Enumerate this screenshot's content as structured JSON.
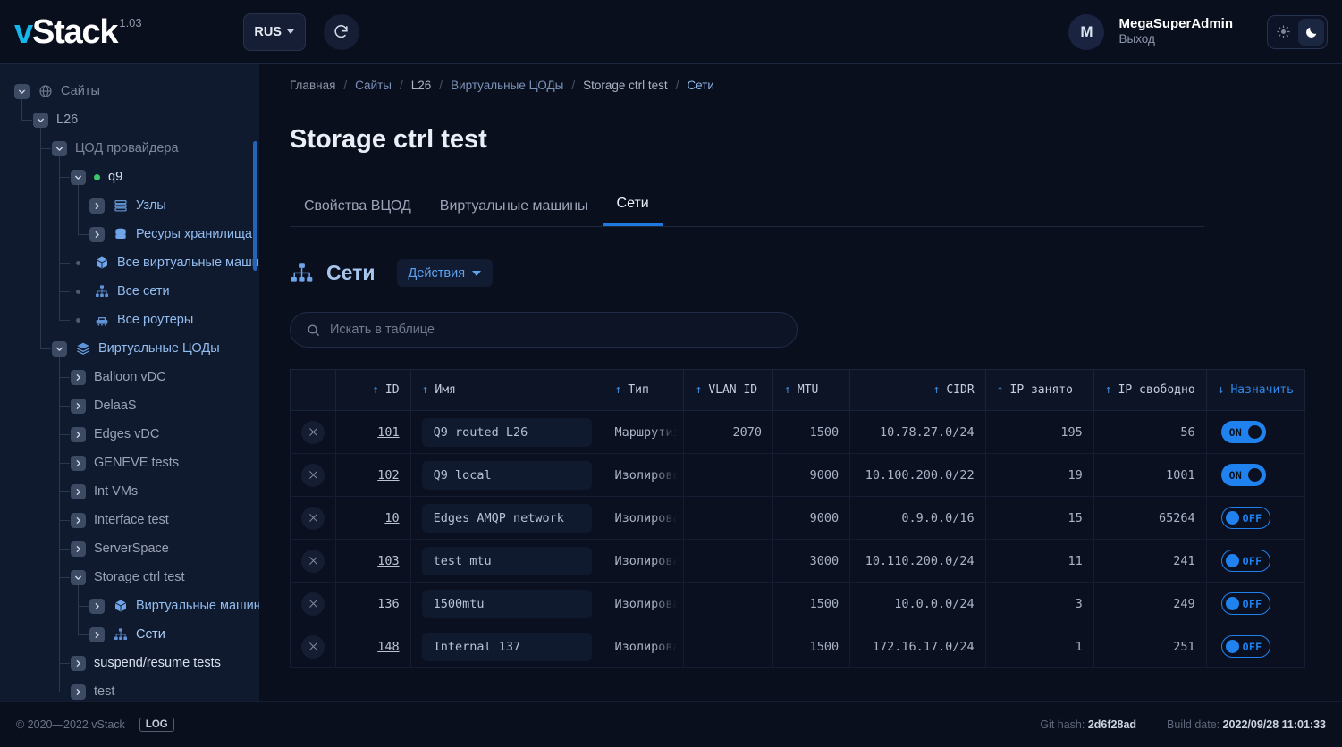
{
  "header": {
    "logo_v": "v",
    "logo_rest": "Stack",
    "version": "1.03",
    "language": "RUS",
    "refresh_icon": "refresh-icon",
    "user_initial": "M",
    "user_name": "MegaSuperAdmin",
    "logout_label": "Выход",
    "theme_light_icon": "sun-icon",
    "theme_dark_icon": "moon-icon",
    "active_theme": "dark"
  },
  "sidebar": {
    "items": [
      {
        "label": "Сайты",
        "indent": 0,
        "state": "expanded",
        "icon": "globe-icon",
        "color": "c-muted"
      },
      {
        "label": "L26",
        "indent": 1,
        "state": "expanded",
        "icon": "",
        "color": "c-dim"
      },
      {
        "label": "ЦОД провайдера",
        "indent": 2,
        "state": "expanded",
        "icon": "",
        "color": "c-muted"
      },
      {
        "label": "q9",
        "indent": 3,
        "state": "expanded",
        "icon": "status-dot",
        "color": "c-white"
      },
      {
        "label": "Узлы",
        "indent": 4,
        "state": "collapsed",
        "icon": "nodes-icon",
        "color": "c-link"
      },
      {
        "label": "Ресуры хранилища",
        "indent": 4,
        "state": "collapsed",
        "icon": "storage-icon",
        "color": "c-link"
      },
      {
        "label": "Все виртуальные машины",
        "indent": 3,
        "state": "leaf",
        "icon": "cube-icon",
        "color": "c-link"
      },
      {
        "label": "Все сети",
        "indent": 3,
        "state": "leaf",
        "icon": "network-icon",
        "color": "c-link"
      },
      {
        "label": "Все роутеры",
        "indent": 3,
        "state": "leaf",
        "icon": "router-icon",
        "color": "c-link"
      },
      {
        "label": "Виртуальные ЦОДы",
        "indent": 2,
        "state": "expanded",
        "icon": "layers-icon",
        "color": "c-link"
      },
      {
        "label": "Balloon vDC",
        "indent": 3,
        "state": "collapsed",
        "icon": "",
        "color": "c-dim"
      },
      {
        "label": "DelaaS",
        "indent": 3,
        "state": "collapsed",
        "icon": "",
        "color": "c-dim"
      },
      {
        "label": "Edges vDC",
        "indent": 3,
        "state": "collapsed",
        "icon": "",
        "color": "c-dim"
      },
      {
        "label": "GENEVE tests",
        "indent": 3,
        "state": "collapsed",
        "icon": "",
        "color": "c-dim"
      },
      {
        "label": "Int VMs",
        "indent": 3,
        "state": "collapsed",
        "icon": "",
        "color": "c-dim"
      },
      {
        "label": "Interface test",
        "indent": 3,
        "state": "collapsed",
        "icon": "",
        "color": "c-dim"
      },
      {
        "label": "ServerSpace",
        "indent": 3,
        "state": "collapsed",
        "icon": "",
        "color": "c-dim"
      },
      {
        "label": "Storage ctrl test",
        "indent": 3,
        "state": "expanded",
        "icon": "",
        "color": "c-dim"
      },
      {
        "label": "Виртуальные машины",
        "indent": 4,
        "state": "collapsed",
        "icon": "cube-icon",
        "color": "c-link"
      },
      {
        "label": "Сети",
        "indent": 4,
        "state": "collapsed",
        "icon": "network-icon",
        "color": "c-linkb"
      },
      {
        "label": "suspend/resume tests",
        "indent": 3,
        "state": "collapsed",
        "icon": "",
        "color": "c-white"
      },
      {
        "label": "test",
        "indent": 3,
        "state": "collapsed",
        "icon": "",
        "color": "c-dim"
      }
    ],
    "collapse_icon": "chevron-left-icon"
  },
  "breadcrumb": [
    {
      "label": "Главная",
      "style": "bc-home"
    },
    {
      "label": "Сайты",
      "style": "bc-link"
    },
    {
      "label": "L26",
      "style": "bc-plain"
    },
    {
      "label": "Виртуальные ЦОДы",
      "style": "bc-link"
    },
    {
      "label": "Storage ctrl test",
      "style": "bc-plain"
    },
    {
      "label": "Сети",
      "style": "bc-active"
    }
  ],
  "breadcrumb_separator": "/",
  "page": {
    "title": "Storage ctrl test",
    "tabs": [
      {
        "label": "Свойства ВЦОД",
        "active": false
      },
      {
        "label": "Виртуальные машины",
        "active": false
      },
      {
        "label": "Сети",
        "active": true
      }
    ],
    "section_title": "Сети",
    "section_icon": "network-icon",
    "actions_label": "Действия"
  },
  "search": {
    "placeholder": "Искать в таблице",
    "value": "",
    "icon": "search-icon"
  },
  "table": {
    "columns": [
      {
        "key": "del",
        "label": "",
        "sort": "",
        "align": "center"
      },
      {
        "key": "id",
        "label": "ID",
        "sort": "asc",
        "align": "right"
      },
      {
        "key": "name",
        "label": "Имя",
        "sort": "asc",
        "align": "left"
      },
      {
        "key": "type",
        "label": "Тип",
        "sort": "asc",
        "align": "left"
      },
      {
        "key": "vlan",
        "label": "VLAN ID",
        "sort": "asc",
        "align": "left"
      },
      {
        "key": "mtu",
        "label": "MTU",
        "sort": "asc",
        "align": "left"
      },
      {
        "key": "cidr",
        "label": "CIDR",
        "sort": "asc",
        "align": "right"
      },
      {
        "key": "busy",
        "label": "IP занято",
        "sort": "asc",
        "align": "left"
      },
      {
        "key": "free",
        "label": "IP свободно",
        "sort": "asc",
        "align": "left"
      },
      {
        "key": "assign",
        "label": "Назначить",
        "sort": "desc",
        "align": "left"
      }
    ],
    "sort_asc_glyph": "↑",
    "sort_desc_glyph": "↓",
    "delete_icon": "close-icon",
    "rows": [
      {
        "id": "101",
        "name": "Q9 routed L26",
        "type": "Маршрутизируемая",
        "vlan": "2070",
        "mtu": "1500",
        "cidr": "10.78.27.0/24",
        "busy": "195",
        "free": "56",
        "assign": "ON"
      },
      {
        "id": "102",
        "name": "Q9 local",
        "type": "Изолированная",
        "vlan": "",
        "mtu": "9000",
        "cidr": "10.100.200.0/22",
        "busy": "19",
        "free": "1001",
        "assign": "ON"
      },
      {
        "id": "10",
        "name": "Edges AMQP network",
        "type": "Изолированная",
        "vlan": "",
        "mtu": "9000",
        "cidr": "0.9.0.0/16",
        "busy": "15",
        "free": "65264",
        "assign": "OFF"
      },
      {
        "id": "103",
        "name": "test mtu",
        "type": "Изолированная",
        "vlan": "",
        "mtu": "3000",
        "cidr": "10.110.200.0/24",
        "busy": "11",
        "free": "241",
        "assign": "OFF"
      },
      {
        "id": "136",
        "name": "1500mtu",
        "type": "Изолированная",
        "vlan": "",
        "mtu": "1500",
        "cidr": "10.0.0.0/24",
        "busy": "3",
        "free": "249",
        "assign": "OFF"
      },
      {
        "id": "148",
        "name": "Internal 137",
        "type": "Изолированная",
        "vlan": "",
        "mtu": "1500",
        "cidr": "172.16.17.0/24",
        "busy": "1",
        "free": "251",
        "assign": "OFF"
      }
    ]
  },
  "footer": {
    "copyright": "© 2020—2022 vStack",
    "log_label": "LOG",
    "git_hash_label": "Git hash:",
    "git_hash_value": "2d6f28ad",
    "build_date_label": "Build date:",
    "build_date_value": "2022/09/28 11:01:33"
  },
  "colors": {
    "accent": "#1f82ef",
    "brand": "#16b5ea",
    "online": "#3cc76a",
    "panel": "#101a2e",
    "bg": "#0a0f1d"
  }
}
